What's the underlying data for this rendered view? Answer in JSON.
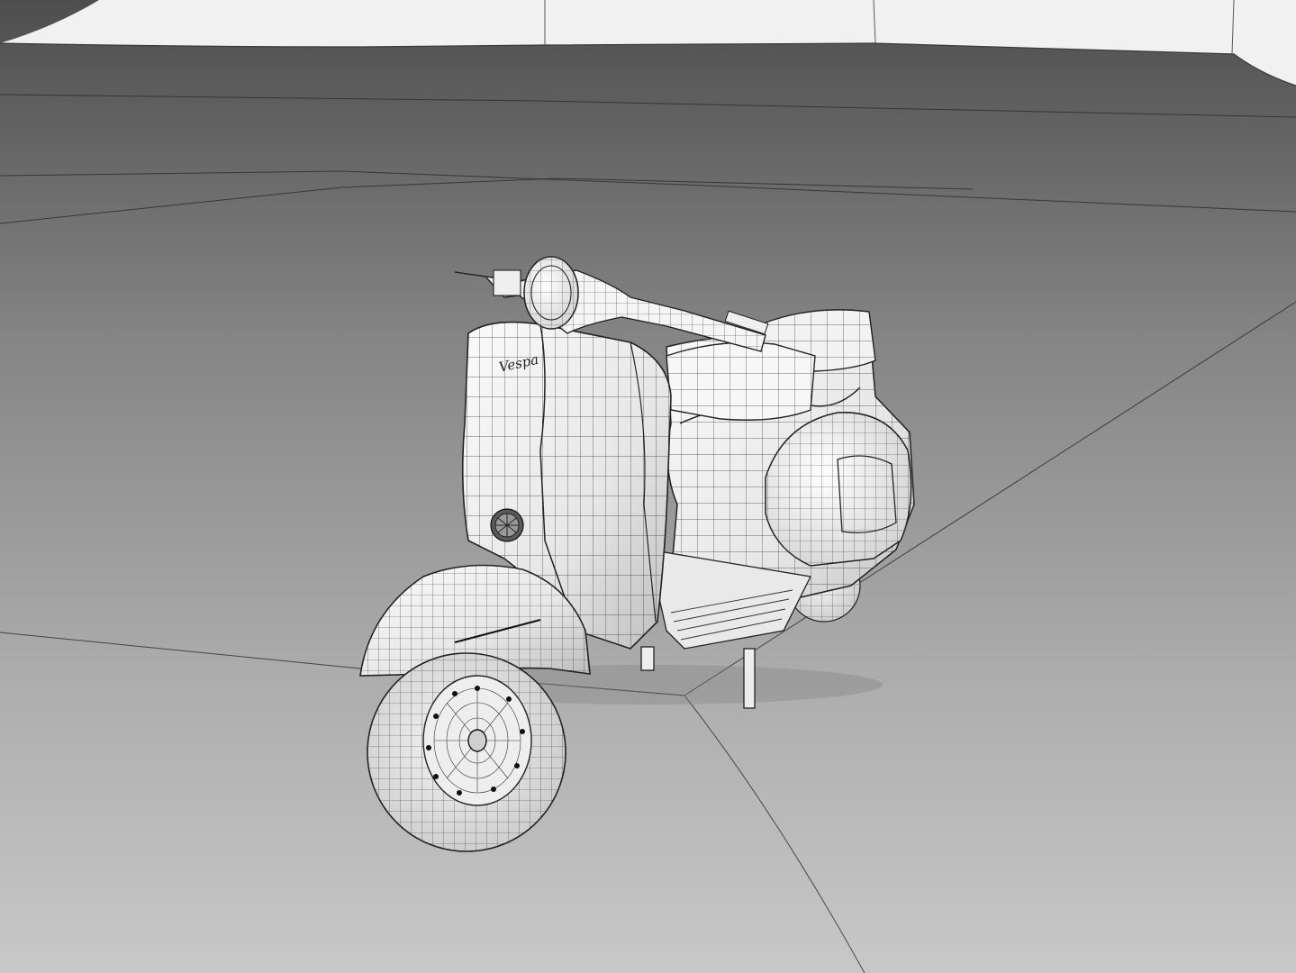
{
  "scene": {
    "subject": "vespa-scooter-wireframe",
    "logo_text": "Vespa",
    "colors": {
      "floor_top": "#555555",
      "floor_mid": "#8e8e8e",
      "floor_bottom": "#c4c4c4",
      "backdrop": "#f2f2f2",
      "wire": "#222222",
      "mesh_fill": "#f4f4f4",
      "mesh_shade": "#cfcfcf"
    }
  }
}
